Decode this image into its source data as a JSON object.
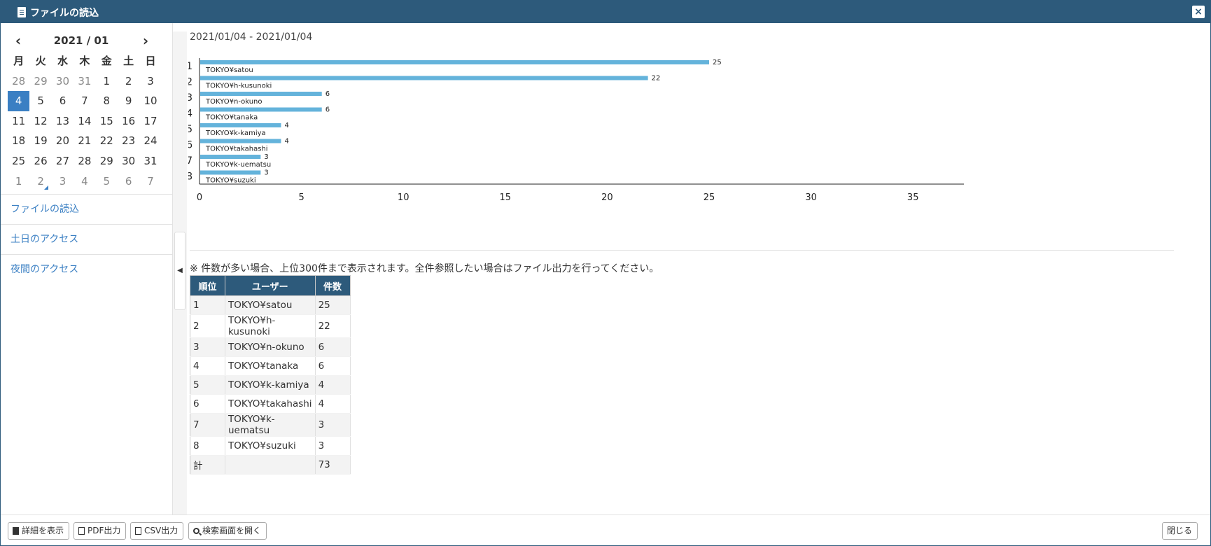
{
  "window": {
    "title": "ファイルの読込",
    "close_glyph": "×"
  },
  "calendar": {
    "prev_glyph": "‹",
    "next_glyph": "›",
    "title": "2021 / 01",
    "dow": [
      "月",
      "火",
      "水",
      "木",
      "金",
      "土",
      "日"
    ],
    "weeks": [
      [
        "28",
        "29",
        "30",
        "31",
        "1",
        "2",
        "3"
      ],
      [
        "4",
        "5",
        "6",
        "7",
        "8",
        "9",
        "10"
      ],
      [
        "11",
        "12",
        "13",
        "14",
        "15",
        "16",
        "17"
      ],
      [
        "18",
        "19",
        "20",
        "21",
        "22",
        "23",
        "24"
      ],
      [
        "25",
        "26",
        "27",
        "28",
        "29",
        "30",
        "31"
      ],
      [
        "1",
        "2",
        "3",
        "4",
        "5",
        "6",
        "7"
      ]
    ],
    "selected": "4"
  },
  "nav": {
    "items": [
      "ファイルの読込",
      "土日のアクセス",
      "夜間のアクセス"
    ]
  },
  "collapse_glyph": "◀",
  "main": {
    "date_range": "2021/01/04 - 2021/01/04",
    "note": "※ 件数が多い場合、上位300件まで表示されます。全件参照したい場合はファイル出力を行ってください。"
  },
  "chart_data": {
    "type": "bar",
    "orientation": "horizontal",
    "categories": [
      "1",
      "2",
      "3",
      "4",
      "5",
      "6",
      "7",
      "8"
    ],
    "bar_labels": [
      "TOKYO¥satou",
      "TOKYO¥h-kusunoki",
      "TOKYO¥n-okuno",
      "TOKYO¥tanaka",
      "TOKYO¥k-kamiya",
      "TOKYO¥takahashi",
      "TOKYO¥k-uematsu",
      "TOKYO¥suzuki"
    ],
    "values": [
      25,
      22,
      6,
      6,
      4,
      4,
      3,
      3
    ],
    "xticks": [
      0,
      5,
      10,
      15,
      20,
      25,
      30,
      35
    ],
    "xlim": [
      0,
      37.5
    ],
    "bar_color": "#64b3db",
    "grid": false
  },
  "table": {
    "headers": [
      "順位",
      "ユーザー",
      "件数"
    ],
    "rows": [
      [
        "1",
        "TOKYO¥satou",
        "25"
      ],
      [
        "2",
        "TOKYO¥h-kusunoki",
        "22"
      ],
      [
        "3",
        "TOKYO¥n-okuno",
        "6"
      ],
      [
        "4",
        "TOKYO¥tanaka",
        "6"
      ],
      [
        "5",
        "TOKYO¥k-kamiya",
        "4"
      ],
      [
        "6",
        "TOKYO¥takahashi",
        "4"
      ],
      [
        "7",
        "TOKYO¥k-uematsu",
        "3"
      ],
      [
        "8",
        "TOKYO¥suzuki",
        "3"
      ]
    ],
    "total": [
      "計",
      "",
      "73"
    ]
  },
  "footer": {
    "show_detail": "詳細を表示",
    "pdf_export": "PDF出力",
    "csv_export": "CSV出力",
    "open_search": "検索画面を開く",
    "close": "閉じる"
  },
  "colors": {
    "header": "#2d5a7b",
    "accent": "#3a7fc3",
    "bar": "#64b3db"
  }
}
